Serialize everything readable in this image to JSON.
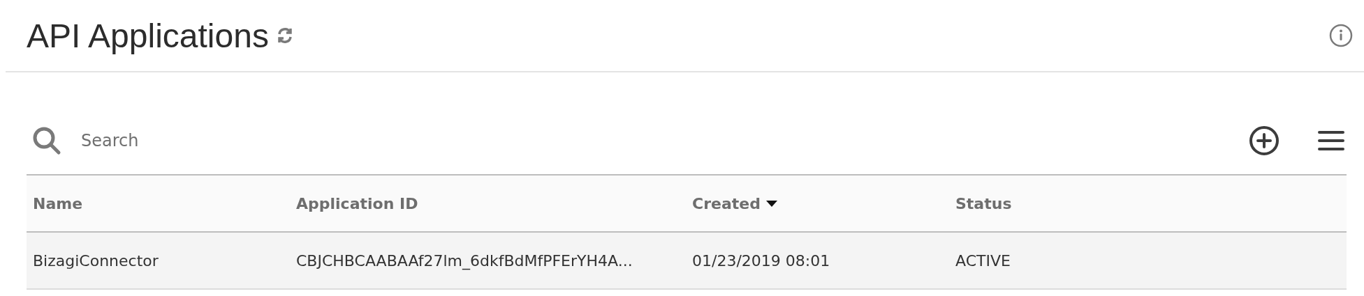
{
  "header": {
    "title": "API Applications"
  },
  "search": {
    "placeholder": "Search"
  },
  "table": {
    "columns": [
      {
        "label": "Name",
        "sorted": false
      },
      {
        "label": "Application ID",
        "sorted": false
      },
      {
        "label": "Created",
        "sorted": true
      },
      {
        "label": "Status",
        "sorted": false
      }
    ],
    "rows": [
      {
        "cells": [
          "BizagiConnector",
          "CBJCHBCAABAAf27lm_6dkfBdMfPFErYH4A...",
          "01/23/2019 08:01",
          "ACTIVE"
        ]
      }
    ]
  }
}
